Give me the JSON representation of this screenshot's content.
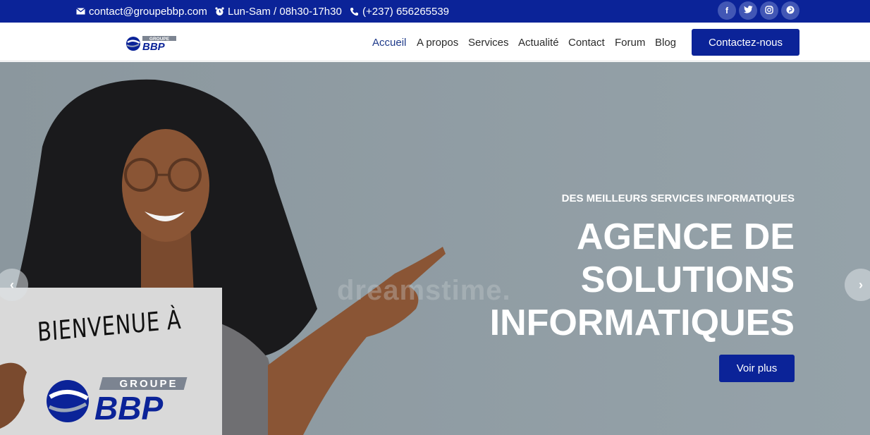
{
  "topbar": {
    "email": "contact@groupebbp.com",
    "hours": "Lun-Sam / 08h30-17h30",
    "phone": "(+237) 656265539",
    "email_icon": "mail-icon",
    "hours_icon": "alarm-clock-icon",
    "phone_icon": "phone-icon",
    "social": [
      {
        "icon": "facebook-icon",
        "glyph": "f"
      },
      {
        "icon": "twitter-icon",
        "glyph": "t"
      },
      {
        "icon": "instagram-icon",
        "glyph": "◎"
      },
      {
        "icon": "pinterest-icon",
        "glyph": "p"
      }
    ]
  },
  "nav": {
    "logo_top": "GROUPE",
    "logo_main": "BBP",
    "links": [
      "Accueil",
      "A propos",
      "Services",
      "Actualité",
      "Contact",
      "Forum",
      "Blog"
    ],
    "active": "Accueil",
    "cta": "Contactez-nous"
  },
  "hero": {
    "eyebrow": "DES MEILLEURS SERVICES INFORMATIQUES",
    "headline": [
      "AGENCE DE",
      "SOLUTIONS",
      "INFORMATIQUES"
    ],
    "button": "Voir plus",
    "sign_text": "BIENVENUE À",
    "sign_logo_top": "GROUPE",
    "sign_logo_main": "BBP",
    "watermark": "dreamstime.",
    "prev": "‹",
    "next": "›"
  },
  "colors": {
    "brand": "#0b2398",
    "hero_bg": "#8f9ca3"
  }
}
